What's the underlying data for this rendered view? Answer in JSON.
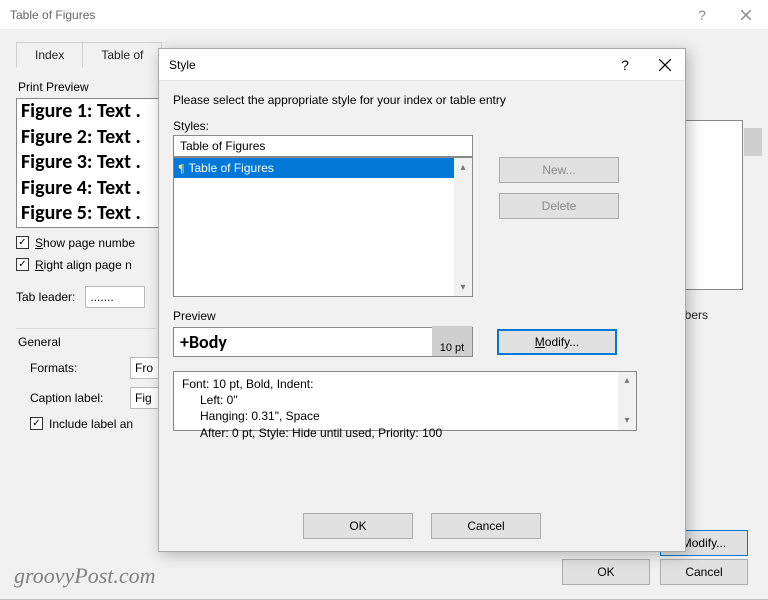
{
  "parent": {
    "title": "Table of Figures",
    "help": "?",
    "tabs": [
      "Index",
      "Table of"
    ],
    "printPreviewLabel": "Print Preview",
    "figures": [
      "Figure 1: Text .",
      "Figure 2: Text .",
      "Figure 3: Text .",
      "Figure 4: Text .",
      "Figure 5: Text ."
    ],
    "showPageNumbers_pre": "S",
    "showPageNumbers": "how page numbe",
    "rightAlign_pre": "R",
    "rightAlign": "ight align page n",
    "numbersText": "umbers",
    "tabLeaderLabel": "Tab leader:",
    "tabLeaderValue": ".......",
    "generalLabel": "General",
    "formatsLabel": "Formats:",
    "formatsValue": "Fro",
    "captionLabel": "Caption label:",
    "captionValue": "Fig",
    "includeLabel": "Include label an",
    "modify": "Modify...",
    "ok": "OK",
    "cancel": "Cancel"
  },
  "style": {
    "title": "Style",
    "help": "?",
    "instruction": "Please select the appropriate style for your index or table entry",
    "stylesLabel": "Styles:",
    "stylesInput": "Table of Figures",
    "stylesSelected": "Table of Figures",
    "new": "New...",
    "delete": "Delete",
    "previewLabel": "Preview",
    "previewBody": "+Body",
    "previewPt": "10 pt",
    "modify_pre": "M",
    "modify": "odify...",
    "desc1": "Font: 10 pt, Bold, Indent:",
    "desc2": "Left:  0\"",
    "desc3": "Hanging:  0.31\", Space",
    "desc4": "After:  0 pt, Style: Hide until used, Priority: 100",
    "ok": "OK",
    "cancel": "Cancel"
  },
  "watermark": "groovyPost.com"
}
